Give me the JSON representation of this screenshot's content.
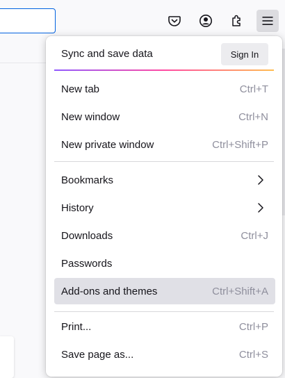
{
  "toolbar": {
    "buttons": [
      {
        "icon": "pocket-icon"
      },
      {
        "icon": "account-icon"
      },
      {
        "icon": "extensions-icon"
      },
      {
        "icon": "hamburger-menu-icon",
        "active": true
      }
    ]
  },
  "menu": {
    "header": {
      "title": "Sync and save data",
      "signin_label": "Sign In"
    },
    "items": [
      {
        "label": "New tab",
        "shortcut": "Ctrl+T"
      },
      {
        "label": "New window",
        "shortcut": "Ctrl+N"
      },
      {
        "label": "New private window",
        "shortcut": "Ctrl+Shift+P"
      },
      {
        "label": "Bookmarks",
        "submenu": true
      },
      {
        "label": "History",
        "submenu": true
      },
      {
        "label": "Downloads",
        "shortcut": "Ctrl+J"
      },
      {
        "label": "Passwords",
        "shortcut": ""
      },
      {
        "label": "Add-ons and themes",
        "shortcut": "Ctrl+Shift+A",
        "highlighted": true
      },
      {
        "label": "Print...",
        "shortcut": "Ctrl+P"
      },
      {
        "label": "Save page as...",
        "shortcut": "Ctrl+S"
      }
    ]
  },
  "colors": {
    "accent": "#0061e0",
    "highlight": "#e0e0e6",
    "shortcut_text": "#8f8f9d",
    "gradient": [
      "#9059ff",
      "#ff4aa2",
      "#ffbd4f"
    ]
  }
}
